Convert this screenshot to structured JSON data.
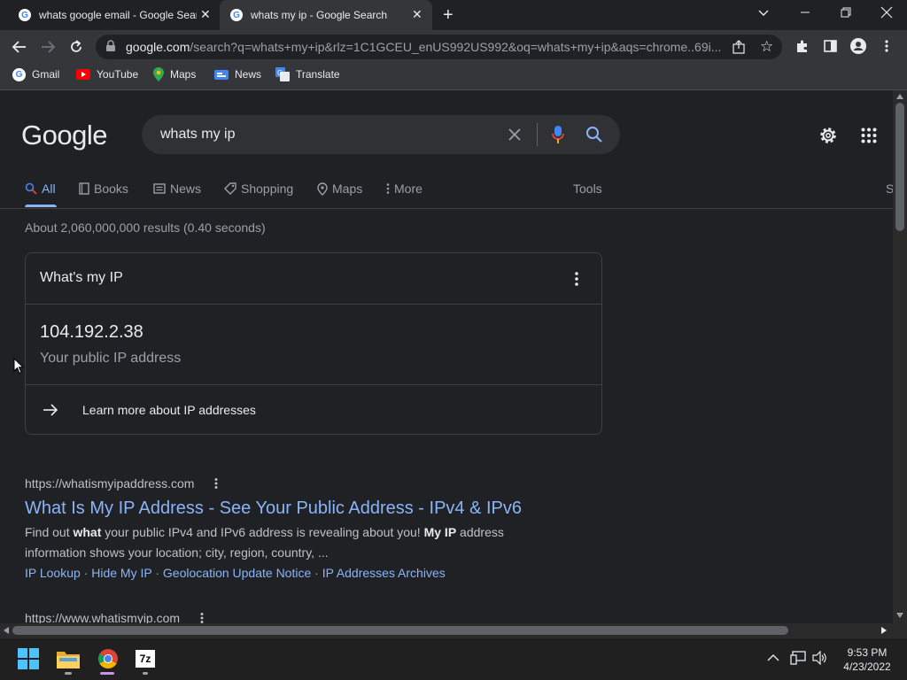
{
  "browser": {
    "tabs": [
      {
        "title": "whats google email - Google Search",
        "active": false
      },
      {
        "title": "whats my ip - Google Search",
        "active": true
      }
    ],
    "new_tab_label": "+",
    "url_host": "google.com",
    "url_rest": "/search?q=whats+my+ip&rlz=1C1GCEU_enUS992US992&oq=whats+my+ip&aqs=chrome..69i...",
    "bookmarks": [
      {
        "label": "Gmail",
        "icon": "google-icon"
      },
      {
        "label": "YouTube",
        "icon": "youtube-icon"
      },
      {
        "label": "Maps",
        "icon": "maps-pin-icon"
      },
      {
        "label": "News",
        "icon": "news-icon"
      },
      {
        "label": "Translate",
        "icon": "translate-icon"
      }
    ]
  },
  "search": {
    "logo": "Google",
    "query": "whats my ip",
    "nav_tabs": [
      {
        "label": "All",
        "icon": "search-icon",
        "active": true
      },
      {
        "label": "Books",
        "icon": "book-icon"
      },
      {
        "label": "News",
        "icon": "news-icon"
      },
      {
        "label": "Shopping",
        "icon": "tag-icon"
      },
      {
        "label": "Maps",
        "icon": "maps-pin-icon"
      },
      {
        "label": "More",
        "icon": "more-vert-icon"
      }
    ],
    "tools_label": "Tools",
    "cut_off_label": "S",
    "result_stats": "About 2,060,000,000 results (0.40 seconds)"
  },
  "ip_card": {
    "title": "What's my IP",
    "ip": "104.192.2.38",
    "subtitle": "Your public IP address",
    "learn_more": "Learn more about IP addresses"
  },
  "results": [
    {
      "url": "https://whatismyipaddress.com",
      "title": "What Is My IP Address - See Your Public Address - IPv4 & IPv6",
      "snippet_1a": "Find out ",
      "snippet_1b": "what",
      "snippet_1c": " your public IPv4 and IPv6 address is revealing about you! ",
      "snippet_1d": "My IP",
      "snippet_1e": " address",
      "snippet_2": "information shows your location; city, region, country, ...",
      "sitelinks": [
        "IP Lookup",
        "Hide My IP",
        "Geolocation Update Notice",
        "IP Addresses Archives"
      ],
      "sitelink_sep": " · "
    },
    {
      "url": "https://www.whatismyip.com"
    }
  ],
  "taskbar": {
    "time": "9:53 PM",
    "date": "4/23/2022",
    "apps": [
      "windows-start-icon",
      "file-explorer-icon",
      "chrome-icon",
      "7zip-icon"
    ],
    "sevenzip_label": "7z"
  },
  "colors": {
    "link": "#8ab4f8",
    "background": "#202124",
    "text_secondary": "#9aa0a6"
  }
}
